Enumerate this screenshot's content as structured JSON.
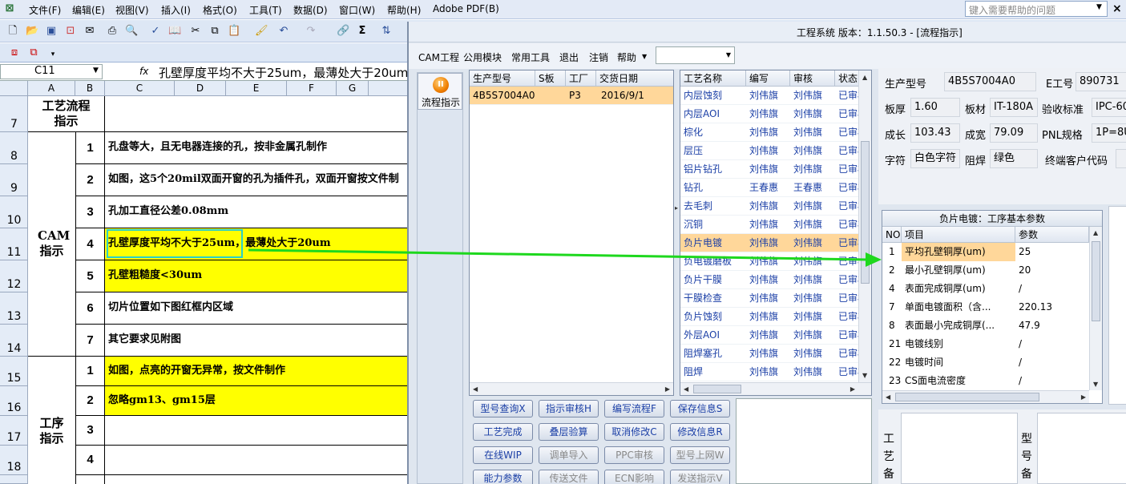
{
  "excel": {
    "menu": [
      "文件(F)",
      "编辑(E)",
      "视图(V)",
      "插入(I)",
      "格式(O)",
      "工具(T)",
      "数据(D)",
      "窗口(W)",
      "帮助(H)",
      "Adobe PDF(B)"
    ],
    "help_placeholder": "键入需要帮助的问题",
    "name_box": "C11",
    "fx": "fx",
    "formula": "孔壁厚度平均不大于25um，最薄处大于20um",
    "columns": [
      "A",
      "B",
      "C",
      "D",
      "E",
      "F",
      "G"
    ],
    "rows": [
      "7",
      "8",
      "9",
      "10",
      "11",
      "12",
      "13",
      "14",
      "15",
      "16",
      "17",
      "18"
    ],
    "sections": {
      "process_guide": "工艺流程指示",
      "cam_guide": "CAM指示",
      "step_guide": "工序指示"
    },
    "cam_items": [
      {
        "n": "1",
        "text": "孔盘等大，且无电器连接的孔，按非金属孔制作",
        "highlight": false
      },
      {
        "n": "2",
        "text": "如图，这5个20mil双面开窗的孔为插件孔，双面开窗按文件制",
        "highlight": false
      },
      {
        "n": "3",
        "text": "孔加工直径公差0.08mm",
        "highlight": false
      },
      {
        "n": "4",
        "text": "孔壁厚度平均不大于25um，最薄处大于20um",
        "highlight": true
      },
      {
        "n": "5",
        "text": "孔壁粗糙度<30um",
        "highlight": true
      },
      {
        "n": "6",
        "text": "切片位置如下图红框内区域",
        "highlight": false
      },
      {
        "n": "7",
        "text": "其它要求见附图",
        "highlight": false
      }
    ],
    "step_items": [
      {
        "n": "1",
        "text": "如图，点亮的开窗无异常，按文件制作",
        "highlight": true
      },
      {
        "n": "2",
        "text": "忽略gm13、gm15层",
        "highlight": true
      },
      {
        "n": "3",
        "text": "",
        "highlight": false
      },
      {
        "n": "4",
        "text": "",
        "highlight": false
      }
    ],
    "colors": {
      "highlight": "#ffff00",
      "active_cell_border": "#2ad0c8",
      "arrow": "#1ed81e"
    }
  },
  "app": {
    "title": "工程系统  版本：1.1.50.3 - [流程指示]",
    "menu": [
      "CAM工程",
      "公用模块",
      "常用工具",
      "退出",
      "注销",
      "帮助"
    ],
    "nav_button": "流程指示",
    "orders": {
      "headers": [
        "生产型号",
        "S板",
        "工厂",
        "交货日期"
      ],
      "rows": [
        {
          "model": "4B5S7004A0",
          "s": "",
          "factory": "P3",
          "date": "2016/9/1"
        }
      ]
    },
    "processes": {
      "headers": [
        "工艺名称",
        "编写",
        "审核",
        "状态"
      ],
      "rows": [
        {
          "name": "内层蚀刻",
          "author": "刘伟旗",
          "reviewer": "刘伟旗",
          "status": "已审核"
        },
        {
          "name": "内层AOI",
          "author": "刘伟旗",
          "reviewer": "刘伟旗",
          "status": "已审核"
        },
        {
          "name": "棕化",
          "author": "刘伟旗",
          "reviewer": "刘伟旗",
          "status": "已审核"
        },
        {
          "name": "层压",
          "author": "刘伟旗",
          "reviewer": "刘伟旗",
          "status": "已审核"
        },
        {
          "name": "铝片钻孔",
          "author": "刘伟旗",
          "reviewer": "刘伟旗",
          "status": "已审核"
        },
        {
          "name": "钻孔",
          "author": "王春惠",
          "reviewer": "王春惠",
          "status": "已审核"
        },
        {
          "name": "去毛刺",
          "author": "刘伟旗",
          "reviewer": "刘伟旗",
          "status": "已审核"
        },
        {
          "name": "沉铜",
          "author": "刘伟旗",
          "reviewer": "刘伟旗",
          "status": "已审核"
        },
        {
          "name": "负片电镀",
          "author": "刘伟旗",
          "reviewer": "刘伟旗",
          "status": "已审核"
        },
        {
          "name": "负电镀磨板",
          "author": "刘伟旗",
          "reviewer": "刘伟旗",
          "status": "已审核"
        },
        {
          "name": "负片干膜",
          "author": "刘伟旗",
          "reviewer": "刘伟旗",
          "status": "已审核"
        },
        {
          "name": "干膜检查",
          "author": "刘伟旗",
          "reviewer": "刘伟旗",
          "status": "已审核"
        },
        {
          "name": "负片蚀刻",
          "author": "刘伟旗",
          "reviewer": "刘伟旗",
          "status": "已审核"
        },
        {
          "name": "外层AOI",
          "author": "刘伟旗",
          "reviewer": "刘伟旗",
          "status": "已审核"
        },
        {
          "name": "阻焊塞孔",
          "author": "刘伟旗",
          "reviewer": "刘伟旗",
          "status": "已审核"
        },
        {
          "name": "阻焊",
          "author": "刘伟旗",
          "reviewer": "刘伟旗",
          "status": "已审核"
        }
      ],
      "selected_index": 8
    },
    "buttons": [
      {
        "label": "型号查询X",
        "enabled": true
      },
      {
        "label": "指示审核H",
        "enabled": true
      },
      {
        "label": "编写流程F",
        "enabled": true
      },
      {
        "label": "保存信息S",
        "enabled": true
      },
      {
        "label": "工艺完成",
        "enabled": true
      },
      {
        "label": "叠层验算",
        "enabled": true
      },
      {
        "label": "取消修改C",
        "enabled": true
      },
      {
        "label": "修改信息R",
        "enabled": true
      },
      {
        "label": "在线WIP",
        "enabled": true
      },
      {
        "label": "调单导入",
        "enabled": false
      },
      {
        "label": "PPC审核",
        "enabled": false
      },
      {
        "label": "型号上网W",
        "enabled": false
      },
      {
        "label": "能力参数",
        "enabled": true
      },
      {
        "label": "传送文件",
        "enabled": false
      },
      {
        "label": "ECN影响",
        "enabled": false
      },
      {
        "label": "发送指示V",
        "enabled": false
      }
    ],
    "info": {
      "model_label": "生产型号",
      "model": "4B5S7004A0",
      "eno_label": "E工号",
      "eno": "890731",
      "thickness_label": "板厚",
      "thickness": "1.60",
      "material_label": "板材",
      "material": "IT-180A",
      "standard_label": "验收标准",
      "standard": "IPC-60",
      "length_label": "成长",
      "length": "103.43",
      "width_label": "成宽",
      "width": "79.09",
      "pnl_label": "PNL规格",
      "pnl": "1P=8U",
      "char_label": "字符",
      "char": "白色字符",
      "mask_label": "阻焊",
      "mask": "绿色",
      "customer_label": "终端客户代码",
      "customer": ""
    },
    "params": {
      "title": "负片电镀：工序基本参数",
      "headers": [
        "NO",
        "项目",
        "参数"
      ],
      "rows": [
        {
          "no": "1",
          "item": "平均孔壁铜厚(um)",
          "value": "25"
        },
        {
          "no": "2",
          "item": "最小孔壁铜厚(um)",
          "value": "20"
        },
        {
          "no": "4",
          "item": "表面完成铜厚(um)",
          "value": "/"
        },
        {
          "no": "7",
          "item": "单面电镀面积（含...",
          "value": "220.13"
        },
        {
          "no": "8",
          "item": "表面最小完成铜厚(...",
          "value": "47.9"
        },
        {
          "no": "21",
          "item": "电镀线别",
          "value": "/"
        },
        {
          "no": "22",
          "item": "电镀时间",
          "value": "/"
        },
        {
          "no": "23",
          "item": "CS面电流密度",
          "value": "/"
        }
      ],
      "selected_index": 0
    },
    "notes": {
      "process_note": "工艺备",
      "model_note": "型号备"
    }
  }
}
